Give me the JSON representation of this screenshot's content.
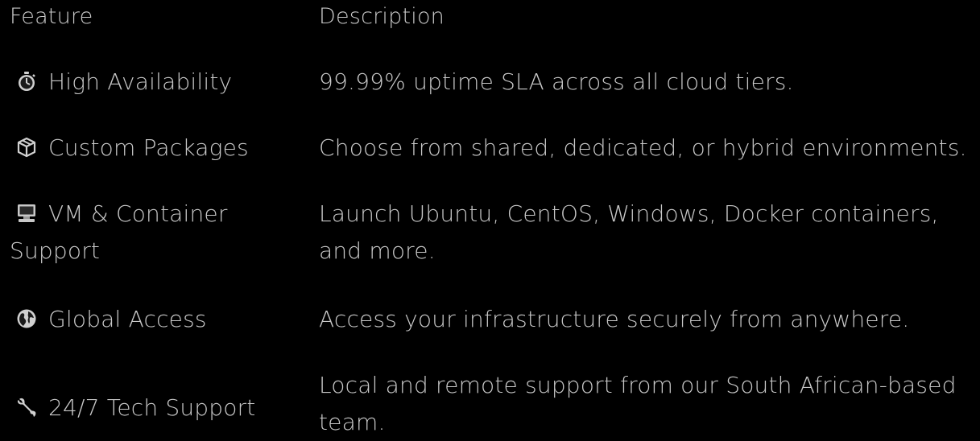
{
  "table": {
    "headers": {
      "feature": "Feature",
      "description": "Description"
    },
    "rows": [
      {
        "icon": "stopwatch-icon",
        "feature": "High Availability",
        "description": "99.99% uptime SLA across all cloud tiers."
      },
      {
        "icon": "package-icon",
        "feature": "Custom Packages",
        "description": "Choose from shared, dedicated, or hybrid environments."
      },
      {
        "icon": "desktop-computer-icon",
        "feature": "VM & Container Support",
        "description": "Launch Ubuntu, CentOS, Windows, Docker containers, and more."
      },
      {
        "icon": "globe-icon",
        "feature": "Global Access",
        "description": "Access your infrastructure securely from anywhere."
      },
      {
        "icon": "wrench-icon",
        "feature": "24/7 Tech Support",
        "description": "Local and remote support from our South African-based team."
      }
    ]
  },
  "colors": {
    "background": "#000000",
    "text": "#c8c8c8"
  }
}
